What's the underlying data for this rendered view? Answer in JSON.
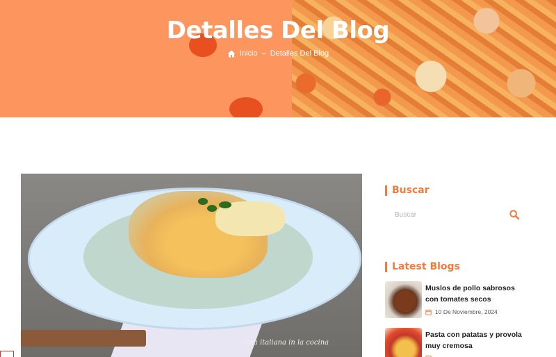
{
  "hero": {
    "title": "Detalles Del Blog",
    "breadcrumb_home": "Inicio",
    "breadcrumb_separator": "–",
    "breadcrumb_current": "Detalles Del Blog",
    "home_icon": "home-icon",
    "background_color": "#fd955f"
  },
  "post": {
    "image_watermark": "Una italiana in la cocina"
  },
  "sidebar": {
    "search": {
      "title": "Buscar",
      "placeholder": "Buscar",
      "value": "",
      "button_icon": "search-icon"
    },
    "latest": {
      "title": "Latest Blogs",
      "items": [
        {
          "title": "Muslos de pollo sabrosos con tomates secos",
          "date": "10 De Noviembre, 2024",
          "date_icon": "calendar-icon"
        },
        {
          "title": "Pasta con patatas y provola muy cremosa",
          "date": "",
          "date_icon": "calendar-icon"
        }
      ]
    },
    "accent_color": "#f07c3c"
  }
}
